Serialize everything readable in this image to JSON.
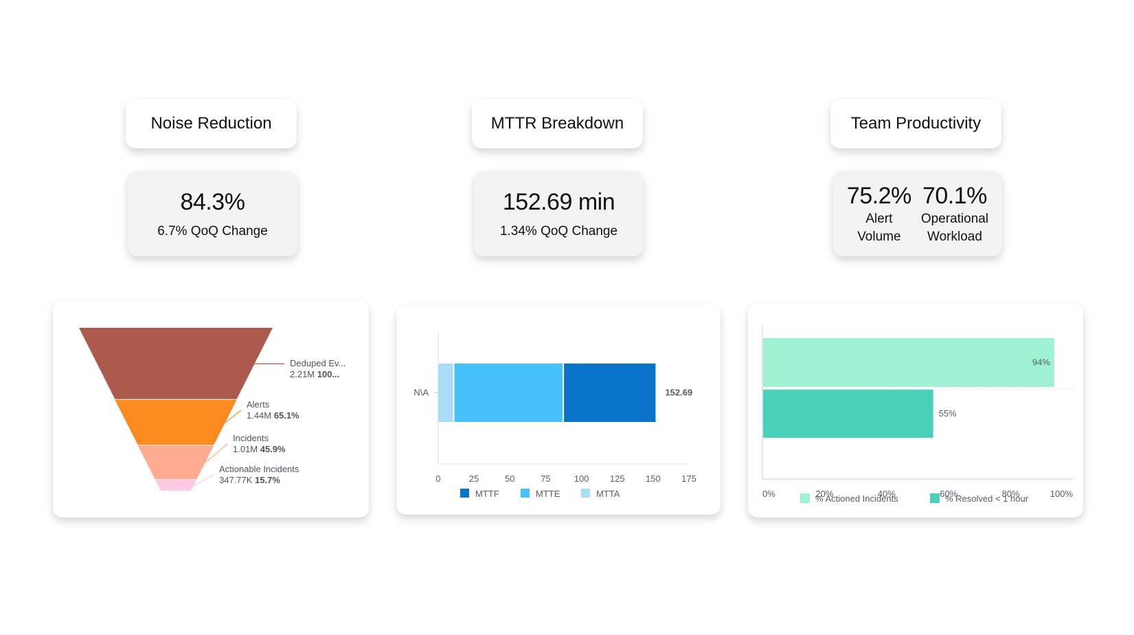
{
  "sections": [
    {
      "title": "Noise Reduction",
      "value": "84.3%",
      "subtitle": "6.7% QoQ Change"
    },
    {
      "title": "MTTR Breakdown",
      "value": "152.69 min",
      "subtitle": "1.34% QoQ Change"
    },
    {
      "title": "Team Productivity",
      "metrics": [
        {
          "value": "75.2%",
          "label_line1": "Alert",
          "label_line2": "Volume"
        },
        {
          "value": "70.1%",
          "label_line1": "Operational",
          "label_line2": "Workload"
        }
      ]
    }
  ],
  "chart_data": [
    {
      "type": "funnel",
      "title": "",
      "stages": [
        {
          "label": "Deduped Ev...",
          "value_text": "2.21M",
          "percent_text": "100...",
          "value": 2210000,
          "percent": 100,
          "color": "#ad5a4e"
        },
        {
          "label": "Alerts",
          "value_text": "1.44M",
          "percent_text": "65.1%",
          "value": 1440000,
          "percent": 65.1,
          "color": "#fb8b1e"
        },
        {
          "label": "Incidents",
          "value_text": "1.01M",
          "percent_text": "45.9%",
          "value": 1010000,
          "percent": 45.9,
          "color": "#ffab91"
        },
        {
          "label": "Actionable Incidents",
          "value_text": "347.77K",
          "percent_text": "15.7%",
          "value": 347770,
          "percent": 15.7,
          "color": "#ffc8e3"
        }
      ]
    },
    {
      "type": "bar",
      "orientation": "horizontal",
      "stacked": true,
      "title": "",
      "categories": [
        "N\\A"
      ],
      "series": [
        {
          "name": "MTTA",
          "values": [
            11.3
          ],
          "color": "#a9dcf7"
        },
        {
          "name": "MTTE",
          "values": [
            76.5
          ],
          "color": "#47c1fc"
        },
        {
          "name": "MTTF",
          "values": [
            64.89
          ],
          "color": "#0a74cb"
        }
      ],
      "total_labels": [
        "152.69"
      ],
      "xlim": [
        0,
        175
      ],
      "xticks": [
        "0",
        "25",
        "50",
        "75",
        "100",
        "125",
        "150",
        "175"
      ],
      "legend": [
        "MTTF",
        "MTTE",
        "MTTA"
      ],
      "legend_position": "bottom",
      "xlabel": "",
      "ylabel": ""
    },
    {
      "type": "bar",
      "orientation": "horizontal",
      "title": "",
      "categories": [
        "% Actioned Incidents",
        "% Resolved < 1 hour"
      ],
      "series": [
        {
          "name": "% Actioned Incidents",
          "values": [
            94
          ],
          "color": "#9ff3d3"
        },
        {
          "name": "% Resolved < 1 hour",
          "values": [
            55
          ],
          "color": "#48d1b8"
        }
      ],
      "data_labels": [
        "94%",
        "55%"
      ],
      "xlim": [
        0,
        100
      ],
      "xticks": [
        "0%",
        "20%",
        "40%",
        "60%",
        "80%",
        "100%"
      ],
      "legend": [
        "% Actioned Incidents",
        "% Resolved < 1 hour"
      ],
      "legend_position": "bottom",
      "xlabel": "",
      "ylabel": ""
    }
  ]
}
